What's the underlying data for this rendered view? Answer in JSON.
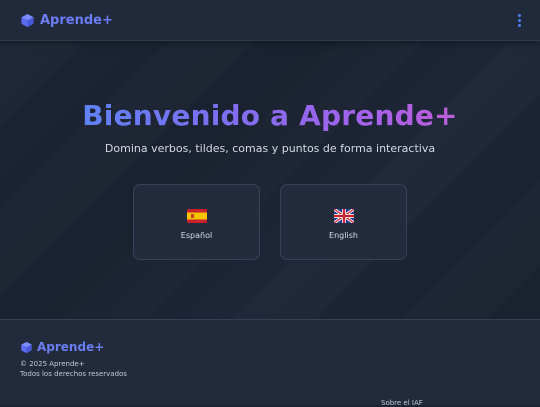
{
  "header": {
    "brand_name": "Aprende+",
    "brand_icon": "cube-icon",
    "menu_icon": "vertical-dots-icon"
  },
  "hero": {
    "title": "Bienvenido a Aprende+",
    "subtitle": "Domina verbos, tildes, comas y puntos de forma interactiva"
  },
  "languages": [
    {
      "flag": "spain-flag-icon",
      "label": "Español"
    },
    {
      "flag": "uk-flag-icon",
      "label": "English"
    }
  ],
  "footer": {
    "brand_name": "Aprende+",
    "copyright": "© 2025 Aprende+",
    "rights": "Todos los derechos reservados",
    "about_link": "Sobre el IAF"
  },
  "colors": {
    "accent": "#6d7cf5",
    "menu_dots": "#4f7df0",
    "title_gradient_start": "#4f8ef7",
    "title_gradient_end": "#d35cc5",
    "background": "#1b2433"
  }
}
